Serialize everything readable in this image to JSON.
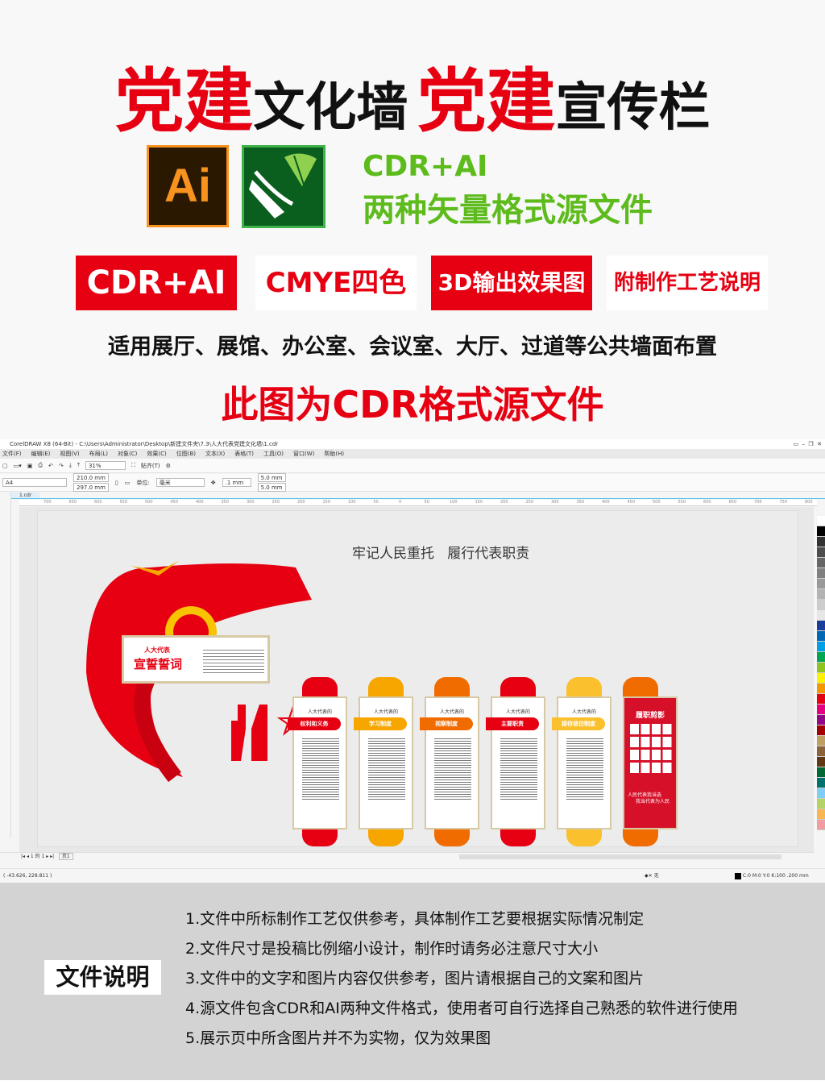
{
  "header": {
    "title_red_1": "党建",
    "title_black_1": "文化墙",
    "title_red_2": "党建",
    "title_black_2": "宣传栏"
  },
  "logos": {
    "ai_label": "Ai",
    "cdr_icon": "coreldraw-pen-balloon-icon"
  },
  "formats": {
    "line1": "CDR+AI",
    "line2": "两种矢量格式源文件"
  },
  "badges": [
    {
      "label": "CDR+AI",
      "style": "red"
    },
    {
      "label": "CMYE四色",
      "style": "white"
    },
    {
      "label": "3D输出效果图",
      "style": "red"
    },
    {
      "label": "附制作工艺说明",
      "style": "white"
    }
  ],
  "usage": "适用展厅、展馆、办公室、会议室、大厅、过道等公共墙面布置",
  "source_note": "此图为CDR格式源文件",
  "corel": {
    "title": "CorelDRAW X8 (64-Bit) - C:\\Users\\Administrator\\Desktop\\新建文件夹\\7.3\\人大代表党建文化墙\\1.cdr",
    "menu": [
      "文件(F)",
      "编辑(E)",
      "视图(V)",
      "布局(L)",
      "对象(C)",
      "效果(C)",
      "位图(B)",
      "文本(X)",
      "表格(T)",
      "工具(O)",
      "窗口(W)",
      "帮助(H)"
    ],
    "zoom": "31%",
    "snap": "贴齐(T)",
    "page_size": "A4",
    "width": "210.0 mm",
    "height": "297.0 mm",
    "unit_label": "单位:",
    "unit": "毫米",
    "nudge": ".1 mm",
    "dup_x": "5.0 mm",
    "dup_y": "5.0 mm",
    "tab": "1.cdr",
    "ruler": [
      "700",
      "650",
      "600",
      "550",
      "500",
      "450",
      "400",
      "350",
      "300",
      "250",
      "200",
      "150",
      "100",
      "50",
      "0",
      "50",
      "100",
      "150",
      "200",
      "250",
      "300",
      "350",
      "400",
      "450",
      "500",
      "550",
      "600",
      "650",
      "700",
      "750",
      "800",
      "850"
    ],
    "page_nav": "1 的 1",
    "page_tab": "页1",
    "coords": "( -43.626, 228.811 )",
    "fill_none": "无",
    "outline_info": "C:0 M:0 Y:0 K:100  .200 mm",
    "palette": [
      "#ffffff",
      "#000000",
      "#333333",
      "#4d4d4d",
      "#666666",
      "#808080",
      "#999999",
      "#b3b3b3",
      "#cccccc",
      "#e6e6e6",
      "#1a3e9e",
      "#0068b7",
      "#00a0e9",
      "#00a650",
      "#8fc31f",
      "#fff100",
      "#f39800",
      "#e60012",
      "#e4007f",
      "#920783",
      "#a40000",
      "#c0a060",
      "#8c6239",
      "#603813",
      "#006934",
      "#00736d",
      "#7ecef4",
      "#b3d465",
      "#f8b551",
      "#f29c9f"
    ]
  },
  "wall": {
    "heading_1": "牢记人民重托",
    "heading_2": "履行代表职责",
    "oath_small": "人大代表",
    "oath_big": "宣誓誓词",
    "panels": [
      {
        "top": "人大代表的",
        "band": "权利和义务",
        "color": "#e60012"
      },
      {
        "top": "人大代表的",
        "band": "学习制度",
        "color": "#f7a600"
      },
      {
        "top": "人大代表的",
        "band": "视察制度",
        "color": "#f06c00"
      },
      {
        "top": "人大代表的",
        "band": "主要职责",
        "color": "#e60012"
      },
      {
        "top": "人大代表的",
        "band": "接待信仿制度",
        "color": "#fbc02d"
      }
    ],
    "photo_panel": {
      "title": "履职剪影",
      "slogan_1": "人民代表我当选",
      "slogan_2": "我当代表为人民",
      "color": "#d7102a"
    }
  },
  "info": {
    "label": "文件说明",
    "items": [
      "1.文件中所标制作工艺仅供参考，具体制作工艺要根据实际情况制定",
      "2.文件尺寸是投稿比例缩小设计，制作时请务必注意尺寸大小",
      "3.文件中的文字和图片内容仅供参考，图片请根据自己的文案和图片",
      "4.源文件包含CDR和AI两种文件格式，使用者可自行选择自己熟悉的软件进行使用",
      "5.展示页中所含图片并不为实物，仅为效果图"
    ]
  },
  "colors": {
    "red": "#e60012",
    "green": "#5dbb1c",
    "info_bg": "#d3d3d3"
  }
}
